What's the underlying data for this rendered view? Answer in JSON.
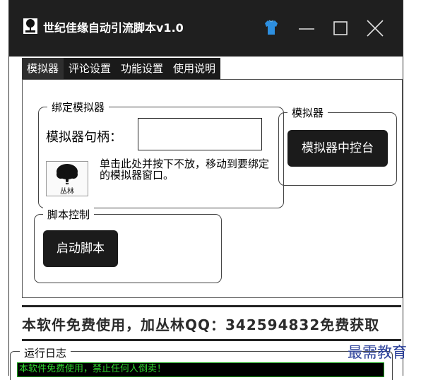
{
  "window": {
    "title": "世纪佳缘自动引流脚本v1.0",
    "controls": {
      "minimize": "minimize",
      "maximize": "maximize",
      "close": "close"
    }
  },
  "tabs": [
    {
      "label": "模拟器",
      "active": true
    },
    {
      "label": "评论设置",
      "active": false
    },
    {
      "label": "功能设置",
      "active": false
    },
    {
      "label": "使用说明",
      "active": false
    }
  ],
  "bind_group": {
    "title": "绑定模拟器",
    "handle_label": "模拟器句柄：",
    "handle_value": "",
    "icon_caption": "丛林",
    "hint": "单击此处并按下不放，移动到要绑定的模拟器窗口。"
  },
  "emulator_group": {
    "title": "模拟器",
    "console_button": "模拟器中控台"
  },
  "script_group": {
    "title": "脚本控制",
    "start_button": "启动脚本"
  },
  "promo_text": "本软件免费使用，加丛林QQ：342594832免费获取",
  "log": {
    "title": "运行日志",
    "lines": [
      "本软件免费使用，禁止任何人倒卖！"
    ]
  },
  "watermark": "最需教育",
  "colors": {
    "titlebar": "#1f1f1f",
    "log_text": "#2fd82f",
    "watermark": "#2a3f9a"
  }
}
